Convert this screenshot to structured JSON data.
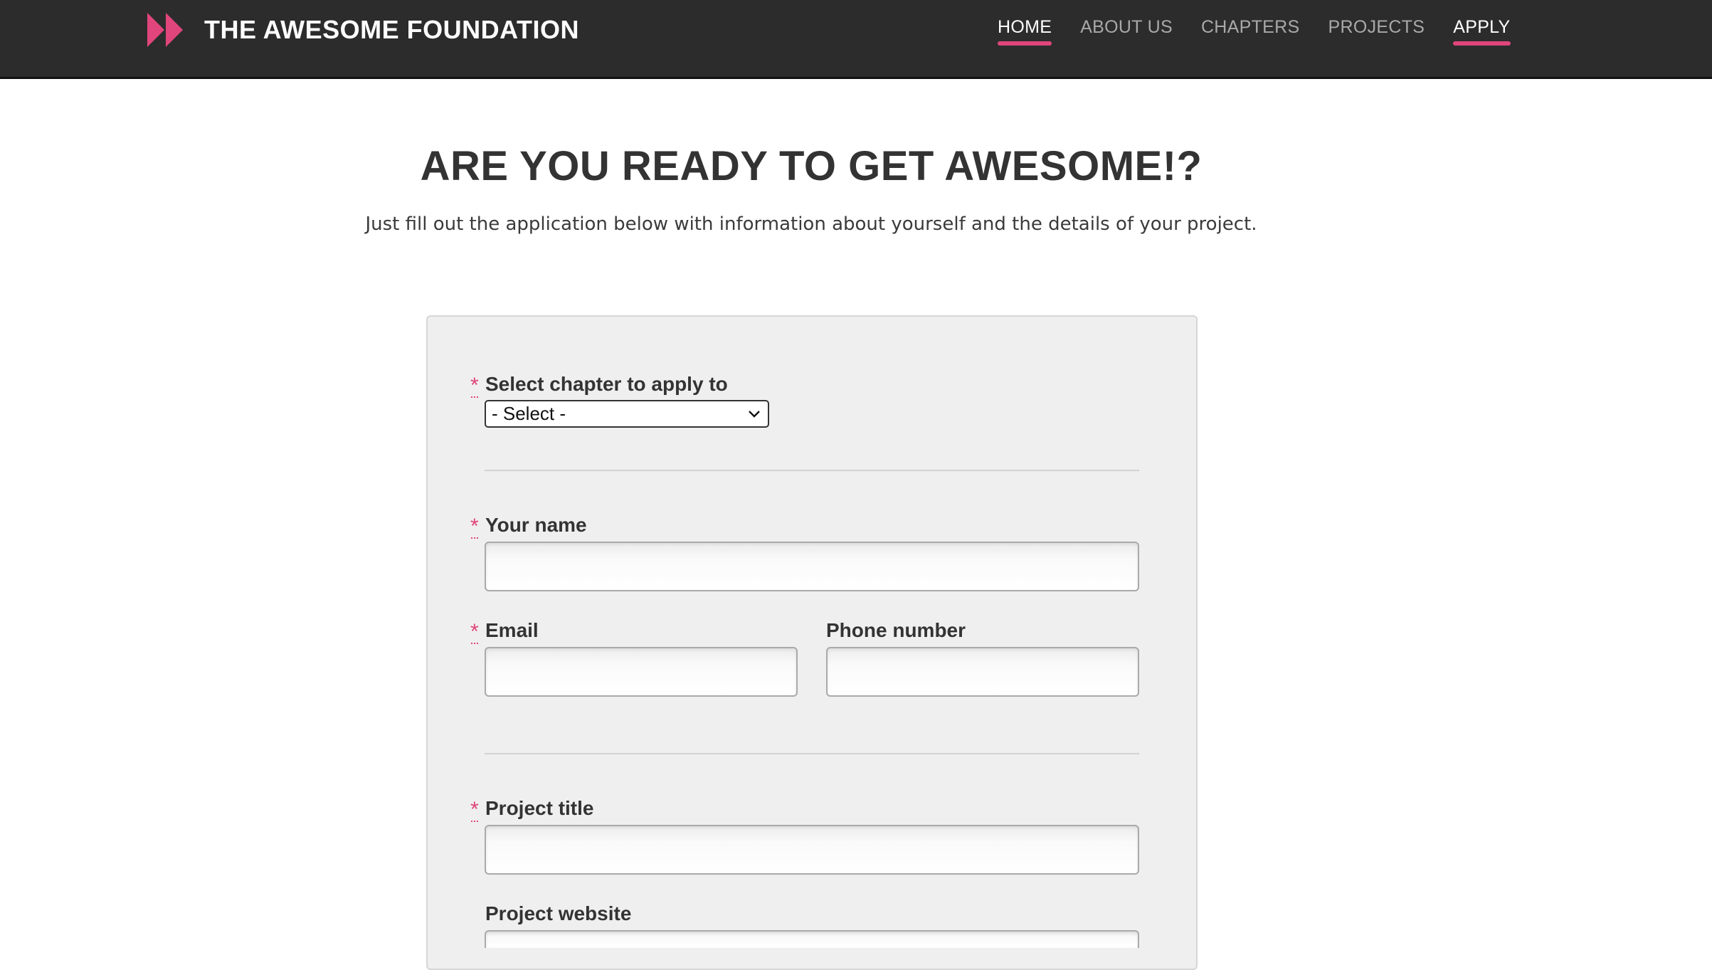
{
  "header": {
    "brand": "THE AWESOME FOUNDATION",
    "logo_icon": "double-chevron-right-icon",
    "accent_color": "#e0457b",
    "background_color": "#2c2c2c",
    "nav": [
      {
        "label": "HOME",
        "active": true
      },
      {
        "label": "ABOUT US",
        "active": false
      },
      {
        "label": "CHAPTERS",
        "active": false
      },
      {
        "label": "PROJECTS",
        "active": false
      },
      {
        "label": "APPLY",
        "active": true
      }
    ]
  },
  "hero": {
    "title": "ARE YOU READY TO GET AWESOME!?",
    "subtitle": "Just fill out the application below with information about yourself and the details of your project."
  },
  "form": {
    "required_marker": "*",
    "chapter": {
      "label": "Select chapter to apply to",
      "value": "- Select -",
      "required": true
    },
    "name": {
      "label": "Your name",
      "value": "",
      "required": true
    },
    "email": {
      "label": "Email",
      "value": "",
      "required": true
    },
    "phone": {
      "label": "Phone number",
      "value": "",
      "required": false
    },
    "project_title": {
      "label": "Project title",
      "value": "",
      "required": true
    },
    "project_website": {
      "label": "Project website",
      "value": "",
      "required": false
    }
  }
}
